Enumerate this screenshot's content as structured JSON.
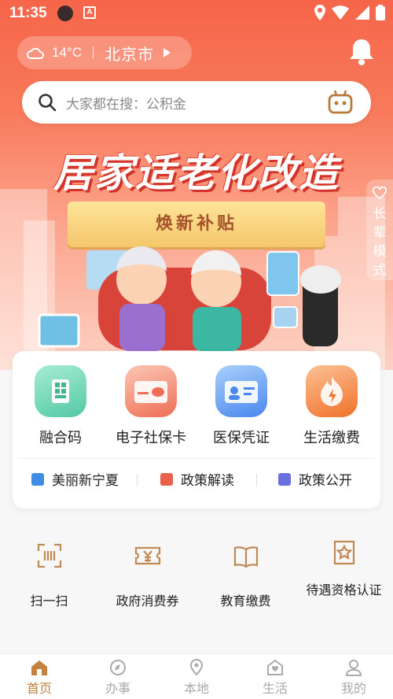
{
  "status": {
    "time": "11:35"
  },
  "weather": {
    "temp": "14°C",
    "city": "北京市"
  },
  "search": {
    "placeholder": "大家都在搜：公积金"
  },
  "banner": {
    "title": "居家适老化改造",
    "ribbon": "焕新补贴",
    "elder_mode": [
      "长",
      "辈",
      "模",
      "式"
    ]
  },
  "services": [
    {
      "label": "融合码",
      "icon": "qr-code-icon",
      "color": "#4cc7a1"
    },
    {
      "label": "电子社保卡",
      "icon": "social-card-icon",
      "color": "#f2785e"
    },
    {
      "label": "医保凭证",
      "icon": "medical-card-icon",
      "color": "#4a8af0"
    },
    {
      "label": "生活缴费",
      "icon": "flame-icon",
      "color": "#f0762e"
    }
  ],
  "links": [
    {
      "label": "美丽新宁夏",
      "color": "#3e8ce6"
    },
    {
      "label": "政策解读",
      "color": "#e8614a"
    },
    {
      "label": "政策公开",
      "color": "#6a6fe0"
    }
  ],
  "grid": [
    {
      "label": "扫一扫",
      "icon": "scan-icon"
    },
    {
      "label": "政府消费券",
      "icon": "coupon-icon"
    },
    {
      "label": "教育缴费",
      "icon": "book-icon"
    },
    {
      "label": "待遇资格认证",
      "icon": "certify-icon"
    }
  ],
  "tabs": [
    {
      "label": "首页",
      "active": true,
      "icon": "home-icon"
    },
    {
      "label": "办事",
      "active": false,
      "icon": "compass-icon"
    },
    {
      "label": "本地",
      "active": false,
      "icon": "location-icon"
    },
    {
      "label": "生活",
      "active": false,
      "icon": "life-icon"
    },
    {
      "label": "我的",
      "active": false,
      "icon": "user-icon"
    }
  ],
  "colors": {
    "accent": "#c4813f",
    "hero": "#f6654a"
  }
}
